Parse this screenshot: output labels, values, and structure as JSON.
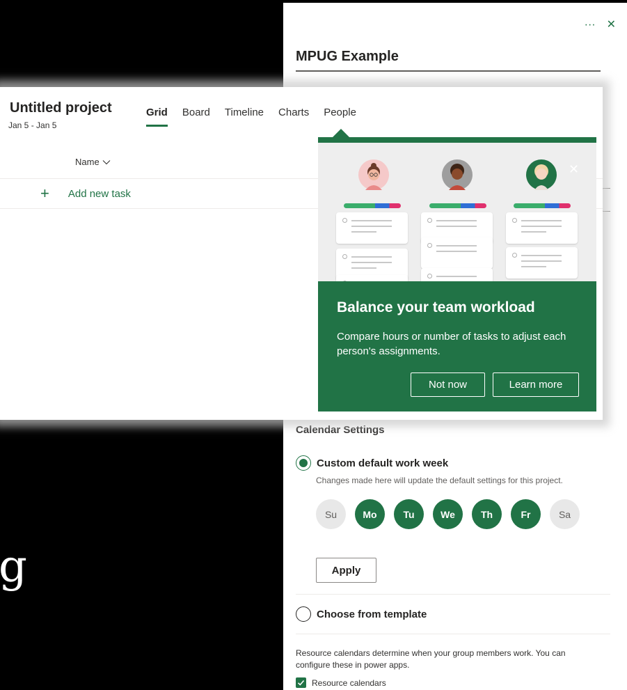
{
  "background_text": "g",
  "side_panel": {
    "title": "MPUG Example",
    "more_label": "···",
    "close_label": "✕",
    "calendar_heading": "Calendar Settings",
    "custom_week": {
      "label": "Custom default work week",
      "selected": true,
      "hint": "Changes made here will update the default settings for this project."
    },
    "days": [
      {
        "label": "Su",
        "selected": false
      },
      {
        "label": "Mo",
        "selected": true
      },
      {
        "label": "Tu",
        "selected": true
      },
      {
        "label": "We",
        "selected": true
      },
      {
        "label": "Th",
        "selected": true
      },
      {
        "label": "Fr",
        "selected": true
      },
      {
        "label": "Sa",
        "selected": false
      }
    ],
    "apply_label": "Apply",
    "template_option": {
      "label": "Choose from template",
      "selected": false
    },
    "resource_text": "Resource calendars determine when your group members work. You can configure these in power apps.",
    "resource_checkbox": {
      "label": "Resource calendars",
      "checked": true
    }
  },
  "planner": {
    "project_title": "Untitled project",
    "date_range": "Jan 5 - Jan 5",
    "tabs": [
      {
        "label": "Grid",
        "active": true
      },
      {
        "label": "Board",
        "active": false
      },
      {
        "label": "Timeline",
        "active": false
      },
      {
        "label": "Charts",
        "active": false
      },
      {
        "label": "People",
        "active": false
      }
    ],
    "name_column": "Name",
    "add_task": "Add new task"
  },
  "callout": {
    "title": "Balance your team workload",
    "body": "Compare hours or number of tasks to adjust each person's assignments.",
    "not_now_label": "Not now",
    "learn_more_label": "Learn more",
    "close_label": "✕"
  },
  "colors": {
    "accent": "#217346",
    "callout_bg": "#217346"
  }
}
